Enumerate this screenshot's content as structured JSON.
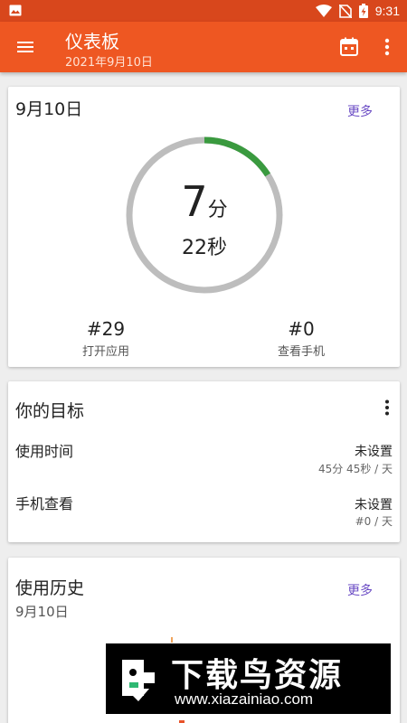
{
  "status_bar": {
    "time": "9:31",
    "icons": [
      "image-icon",
      "wifi-icon",
      "no-sim-icon",
      "battery-charging-icon"
    ]
  },
  "app_bar": {
    "title": "仪表板",
    "subtitle": "2021年9月10日",
    "icons": [
      "menu-icon",
      "calendar-icon",
      "more-vert-icon"
    ]
  },
  "today_card": {
    "date": "9月10日",
    "more_label": "更多",
    "ring": {
      "minutes": "7",
      "minutes_unit": "分",
      "seconds_text": "22秒",
      "progress": 0.16,
      "track_color": "#bdbdbd",
      "progress_color": "#3a9a3f"
    },
    "stats": [
      {
        "value": "#29",
        "label": "打开应用"
      },
      {
        "value": "#0",
        "label": "查看手机"
      }
    ]
  },
  "goals_card": {
    "title": "你的目标",
    "items": [
      {
        "name": "使用时间",
        "status": "未设置",
        "target": "45分 45秒 / 天"
      },
      {
        "name": "手机查看",
        "status": "未设置",
        "target": "#0 / 天"
      }
    ]
  },
  "history_card": {
    "title": "使用历史",
    "date": "9月10日",
    "more_label": "更多"
  },
  "watermark": {
    "brand": "下载鸟资源",
    "url": "www.xiazainiao.com"
  },
  "colors": {
    "status_bar": "#d8471c",
    "app_bar": "#ee5722",
    "link": "#6a4bc4",
    "accent_marks": "#f0a35b"
  }
}
